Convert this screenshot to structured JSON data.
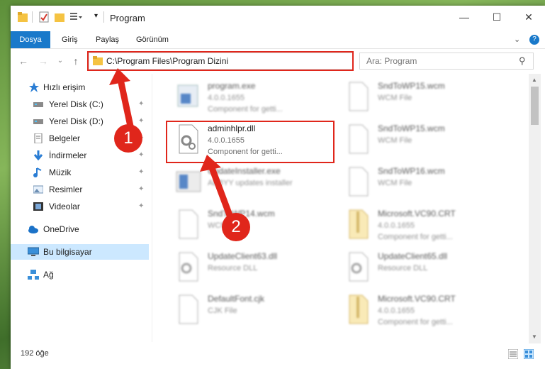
{
  "window": {
    "title": "Program",
    "minimize_glyph": "—",
    "maximize_glyph": "☐",
    "close_glyph": "✕"
  },
  "ribbon": {
    "tabs": [
      {
        "label": "Dosya"
      },
      {
        "label": "Giriş"
      },
      {
        "label": "Paylaş"
      },
      {
        "label": "Görünüm"
      }
    ],
    "expand_glyph": "⌄",
    "help_glyph": "?"
  },
  "nav": {
    "back_glyph": "←",
    "forward_glyph": "→",
    "recent_glyph": "⌄",
    "up_glyph": "↑",
    "address": "C:\\Program Files\\Program Dizini",
    "address_dropdown_glyph": "⌄",
    "refresh_glyph": "↻",
    "search_placeholder": "Ara: Program",
    "search_glyph": "⚲"
  },
  "sidebar": {
    "items": [
      {
        "label": "Hızlı erişim",
        "icon": "star-icon"
      },
      {
        "label": "Yerel Disk (C:)",
        "icon": "drive-icon",
        "pinned": true
      },
      {
        "label": "Yerel Disk (D:)",
        "icon": "drive-icon",
        "pinned": true
      },
      {
        "label": "Belgeler",
        "icon": "document-icon",
        "pinned": true
      },
      {
        "label": "İndirmeler",
        "icon": "download-icon",
        "pinned": true
      },
      {
        "label": "Müzik",
        "icon": "music-icon",
        "pinned": true
      },
      {
        "label": "Resimler",
        "icon": "pictures-icon",
        "pinned": true
      },
      {
        "label": "Videolar",
        "icon": "video-icon",
        "pinned": true
      },
      {
        "label": "OneDrive",
        "icon": "cloud-icon"
      },
      {
        "label": "Bu bilgisayar",
        "icon": "computer-icon",
        "selected": true
      },
      {
        "label": "Ağ",
        "icon": "network-icon"
      }
    ],
    "pin_glyph": "📌"
  },
  "files": [
    {
      "name": "program.exe",
      "line2": "4.0.0.1655",
      "line3": "Component for getti...",
      "icon": "exe-icon"
    },
    {
      "name": "SndToWP15.wcm",
      "line2": "WCM File",
      "line3": "",
      "icon": "blank-file-icon"
    },
    {
      "name": "adminhlpr.dll",
      "line2": "4.0.0.1655",
      "line3": "Component for getti...",
      "icon": "dll-gear-icon",
      "highlighted": true
    },
    {
      "name": "SndToWP15.wcm",
      "line2": "WCM File",
      "line3": "",
      "icon": "blank-file-icon"
    },
    {
      "name": "UpdateInstaller.exe",
      "line2": "ABBYY updates installer",
      "line3": "",
      "icon": "installer-icon"
    },
    {
      "name": "SndToWP16.wcm",
      "line2": "WCM File",
      "line3": "",
      "icon": "blank-file-icon"
    },
    {
      "name": "SndToWP14.wcm",
      "line2": "WCM File",
      "line3": "",
      "icon": "blank-file-icon"
    },
    {
      "name": "Microsoft.VC90.CRT",
      "line2": "4.0.0.1655",
      "line3": "Component for getti...",
      "icon": "zip-file-icon"
    },
    {
      "name": "UpdateClient63.dll",
      "line2": "Resource DLL",
      "line3": "",
      "icon": "dll-gear-icon"
    },
    {
      "name": "UpdateClient65.dll",
      "line2": "Resource DLL",
      "line3": "",
      "icon": "dll-gear-icon"
    },
    {
      "name": "DefaultFont.cjk",
      "line2": "CJK File",
      "line3": "",
      "icon": "blank-file-icon"
    },
    {
      "name": "Microsoft.VC90.CRT",
      "line2": "4.0.0.1655",
      "line3": "Component for getti...",
      "icon": "zip-file-icon"
    }
  ],
  "status": {
    "item_count": "192 öğe"
  },
  "annotations": [
    {
      "label": "1"
    },
    {
      "label": "2"
    }
  ],
  "colors": {
    "accent": "#1979ca",
    "highlight_red": "#e0261b",
    "selected_nav": "#cce8ff"
  }
}
